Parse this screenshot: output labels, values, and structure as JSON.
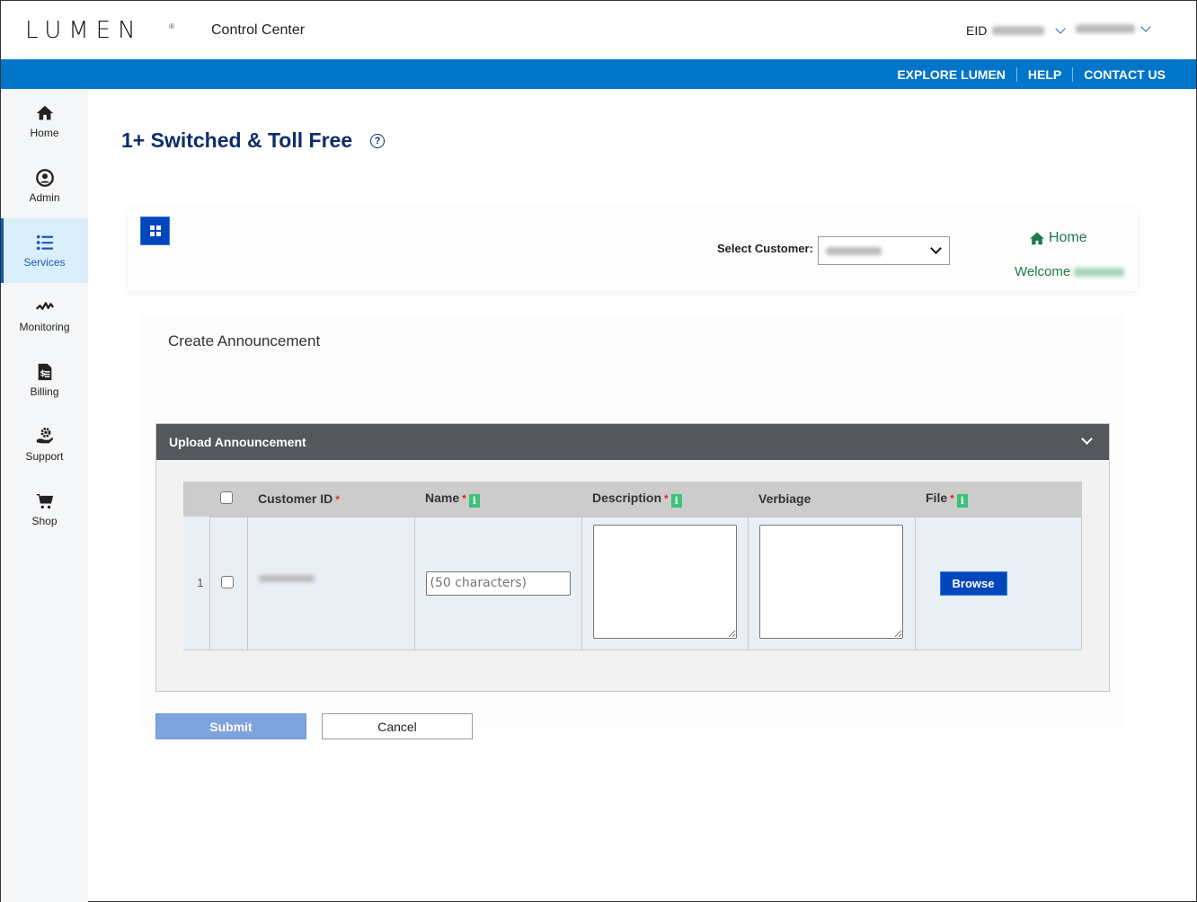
{
  "header": {
    "logo": "LUMEN",
    "app_title": "Control Center",
    "eid_label": "EID",
    "eid_value": "[redacted]",
    "user_value": "[redacted]"
  },
  "top_nav": {
    "links": [
      "EXPLORE LUMEN",
      "HELP",
      "CONTACT US"
    ]
  },
  "sidebar": {
    "items": [
      {
        "label": "Home",
        "icon": "home-icon",
        "active": false
      },
      {
        "label": "Admin",
        "icon": "user-circle-icon",
        "active": false
      },
      {
        "label": "Services",
        "icon": "list-icon",
        "active": true
      },
      {
        "label": "Monitoring",
        "icon": "pulse-icon",
        "active": false
      },
      {
        "label": "Billing",
        "icon": "invoice-icon",
        "active": false
      },
      {
        "label": "Support",
        "icon": "support-gear-icon",
        "active": false
      },
      {
        "label": "Shop",
        "icon": "cart-icon",
        "active": false
      }
    ]
  },
  "page": {
    "title": "1+ Switched & Toll Free",
    "help_glyph": "?"
  },
  "toolbar": {
    "select_customer_label": "Select Customer:",
    "select_customer_value": "[redacted]",
    "home_link": "Home",
    "welcome_text": "Welcome",
    "welcome_user": "[redacted]"
  },
  "card": {
    "title": "Create Announcement"
  },
  "panel": {
    "title": "Upload Announcement",
    "columns": [
      {
        "label": "",
        "type": "checkbox"
      },
      {
        "label": "Customer ID",
        "required": true,
        "info": false
      },
      {
        "label": "Name",
        "required": true,
        "info": true
      },
      {
        "label": "Description",
        "required": true,
        "info": true
      },
      {
        "label": "Verbiage",
        "required": false,
        "info": false
      },
      {
        "label": "File",
        "required": true,
        "info": true
      }
    ],
    "rows": [
      {
        "row_number": "1",
        "customer_id": "[redacted]",
        "name_placeholder": "(50 characters)",
        "name_value": "",
        "description": "",
        "verbiage": "",
        "browse_label": "Browse"
      }
    ]
  },
  "actions": {
    "submit_label": "Submit",
    "cancel_label": "Cancel"
  },
  "colors": {
    "brand_blue": "#0075c9",
    "primary_button": "#0047bb",
    "title_navy": "#0c2d6b",
    "link_green": "#1d7a49",
    "panel_header": "#54575b",
    "info_green": "#3cc27a"
  }
}
